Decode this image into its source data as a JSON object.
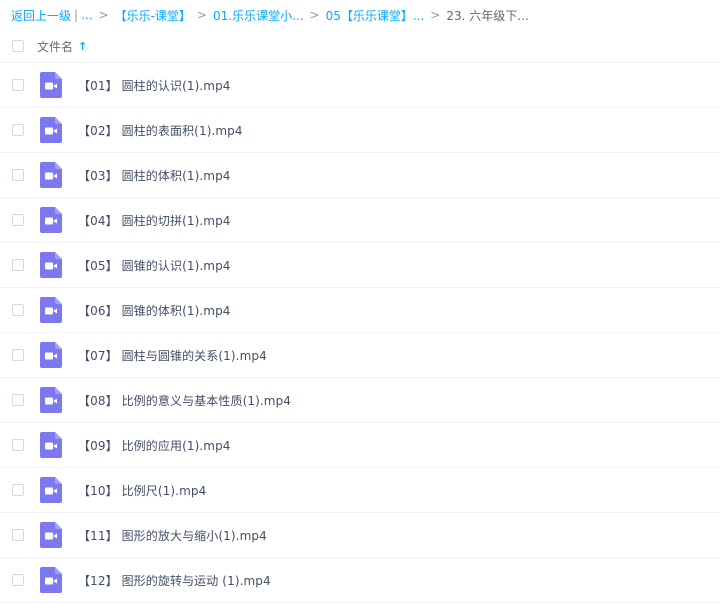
{
  "breadcrumb": {
    "back": "返回上一级",
    "divider": "|",
    "ellipsis": "...",
    "sep": ">",
    "items": [
      "【乐乐-课堂】",
      "01.乐乐课堂小...",
      "05【乐乐课堂】..."
    ],
    "current": "23. 六年级下..."
  },
  "header": {
    "column_name": "文件名",
    "sort_icon": "arrow-up-icon"
  },
  "files": [
    {
      "name": "【01】 圆柱的认识(1).mp4",
      "icon": "video-file-icon"
    },
    {
      "name": "【02】 圆柱的表面积(1).mp4",
      "icon": "video-file-icon"
    },
    {
      "name": "【03】 圆柱的体积(1).mp4",
      "icon": "video-file-icon"
    },
    {
      "name": "【04】 圆柱的切拼(1).mp4",
      "icon": "video-file-icon"
    },
    {
      "name": "【05】 圆锥的认识(1).mp4",
      "icon": "video-file-icon"
    },
    {
      "name": "【06】 圆锥的体积(1).mp4",
      "icon": "video-file-icon"
    },
    {
      "name": "【07】 圆柱与圆锥的关系(1).mp4",
      "icon": "video-file-icon"
    },
    {
      "name": "【08】 比例的意义与基本性质(1).mp4",
      "icon": "video-file-icon"
    },
    {
      "name": "【09】 比例的应用(1).mp4",
      "icon": "video-file-icon"
    },
    {
      "name": "【10】 比例尺(1).mp4",
      "icon": "video-file-icon"
    },
    {
      "name": "【11】 图形的放大与缩小(1).mp4",
      "icon": "video-file-icon"
    },
    {
      "name": "【12】 图形的旋转与运动 (1).mp4",
      "icon": "video-file-icon"
    }
  ],
  "colors": {
    "link": "#09aaff",
    "icon": "#7b78f2",
    "text": "#424e67"
  }
}
